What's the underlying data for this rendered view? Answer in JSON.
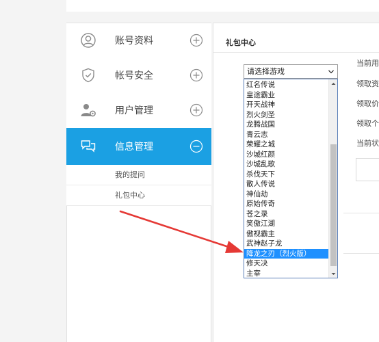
{
  "sidebar": {
    "items": [
      {
        "label": "账号资料",
        "icon": "user-circle-icon",
        "toggle": "plus-circle-icon"
      },
      {
        "label": "帐号安全",
        "icon": "shield-check-icon",
        "toggle": "plus-circle-icon"
      },
      {
        "label": "用户管理",
        "icon": "user-gear-icon",
        "toggle": "plus-circle-icon"
      },
      {
        "label": "信息管理",
        "icon": "chat-bubbles-icon",
        "toggle": "minus-circle-icon",
        "active": true
      }
    ],
    "subitems": [
      {
        "label": "我的提问"
      },
      {
        "label": "礼包中心"
      }
    ]
  },
  "main": {
    "title": "礼包中心",
    "labels": [
      "当前用户",
      "领取资格",
      "领取价格",
      "领取个数",
      "当前状态"
    ]
  },
  "select": {
    "value": "请选择游戏",
    "options": [
      "红名传说",
      "皇途霸业",
      "开天战神",
      "烈火剑圣",
      "龙腾战国",
      "青云志",
      "荣耀之城",
      "沙城红颜",
      "沙城乱歌",
      "杀伐天下",
      "散人传说",
      "神仙劫",
      "原始传奇",
      "苍之录",
      "笑傲江湖",
      "傲视霸主",
      "武神赵子龙",
      "降龙之刃（烈火版）",
      "修天决",
      "主宰"
    ],
    "selected_index": 17
  },
  "colors": {
    "accent": "#1ba0e3",
    "selected_option": "#1e90ff",
    "annotation_arrow": "#e53935"
  }
}
